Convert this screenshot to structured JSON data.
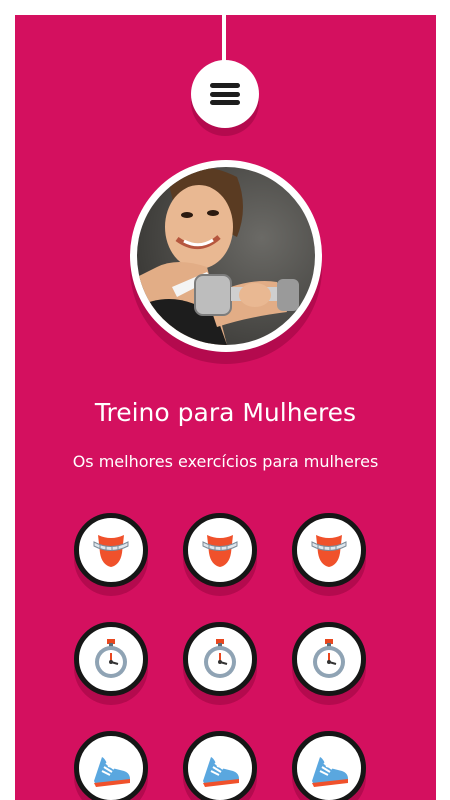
{
  "header": {
    "menu_icon": "hamburger-menu-icon"
  },
  "profile": {
    "image": "woman-lifting-dumbbell-photo",
    "title": "Treino para Mulheres",
    "subtitle": "Os melhores exercícios para mulheres"
  },
  "categories": [
    {
      "icon": "waist-measure-icon"
    },
    {
      "icon": "waist-measure-icon"
    },
    {
      "icon": "waist-measure-icon"
    },
    {
      "icon": "stopwatch-icon"
    },
    {
      "icon": "stopwatch-icon"
    },
    {
      "icon": "stopwatch-icon"
    },
    {
      "icon": "sneaker-icon"
    },
    {
      "icon": "sneaker-icon"
    },
    {
      "icon": "sneaker-icon"
    }
  ],
  "colors": {
    "background": "#d4105f",
    "tile_border": "#161616",
    "icon_red": "#f0512b",
    "icon_blue": "#5aa7df"
  }
}
